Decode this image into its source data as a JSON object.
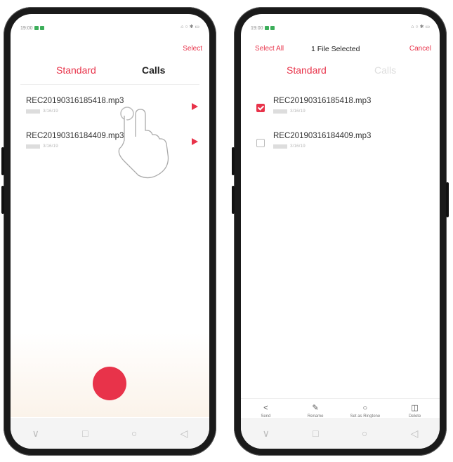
{
  "left_screen": {
    "status": {
      "time": "19:00",
      "right_icons": "⌂ ○ ✱ ▭"
    },
    "top_action": "Select",
    "tabs": [
      {
        "label": "Standard"
      },
      {
        "label": "Calls"
      }
    ],
    "files": [
      {
        "name": "REC20190316185418.mp3",
        "date": "3/16/19"
      },
      {
        "name": "REC20190316184409.mp3",
        "date": "3/16/19"
      }
    ]
  },
  "right_screen": {
    "status": {
      "time": "19:00",
      "right_icons": "⌂ ○ ✱ ▭"
    },
    "select_all": "Select All",
    "selected_text": "1 File Selected",
    "cancel": "Cancel",
    "tabs": [
      {
        "label": "Standard"
      },
      {
        "label": "Calls"
      }
    ],
    "files": [
      {
        "name": "REC20190316185418.mp3",
        "date": "3/16/19",
        "checked": true
      },
      {
        "name": "REC20190316184409.mp3",
        "date": "3/16/19",
        "checked": false
      }
    ],
    "actions": [
      {
        "label": "Send",
        "icon": "share-icon"
      },
      {
        "label": "Rename",
        "icon": "edit-icon"
      },
      {
        "label": "Set as Ringtone",
        "icon": "bell-icon"
      },
      {
        "label": "Delete",
        "icon": "trash-icon"
      }
    ]
  },
  "nav_icons": {
    "menu": "∨",
    "home": "□",
    "circle": "○",
    "back": "◁"
  },
  "colors": {
    "accent": "#e8334a",
    "record_bg": "#fbf3ea"
  }
}
